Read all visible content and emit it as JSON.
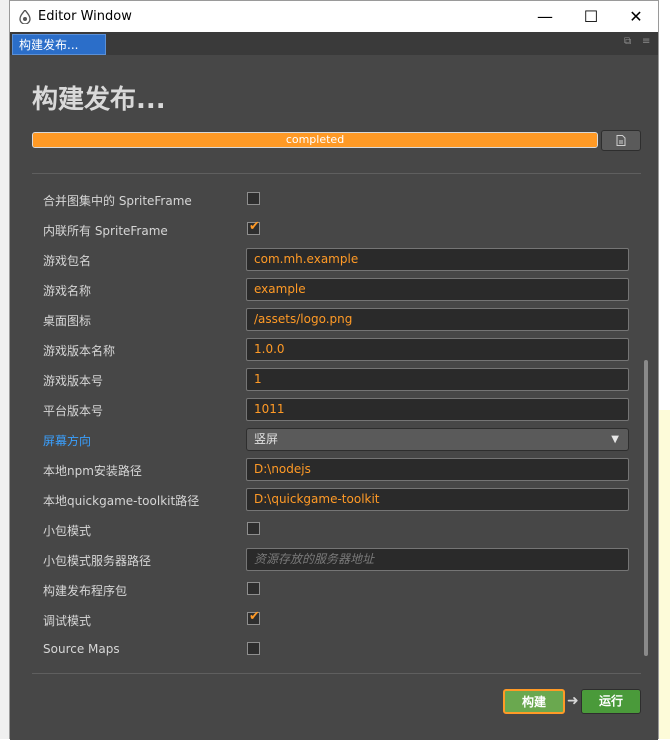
{
  "window": {
    "title": "Editor Window",
    "controls": {
      "minimize": "—",
      "maximize": "☐",
      "close": "✕"
    }
  },
  "tab": {
    "label": "构建发布..."
  },
  "panel": {
    "heading": "构建发布...",
    "progress": {
      "label": "completed",
      "percent": 100
    },
    "fields": [
      {
        "label": "合并图集中的 SpriteFrame",
        "type": "checkbox",
        "checked": false
      },
      {
        "label": "内联所有 SpriteFrame",
        "type": "checkbox",
        "checked": true
      },
      {
        "label": "游戏包名",
        "type": "text",
        "value": "com.mh.example"
      },
      {
        "label": "游戏名称",
        "type": "text",
        "value": "example"
      },
      {
        "label": "桌面图标",
        "type": "text",
        "value": "/assets/logo.png"
      },
      {
        "label": "游戏版本名称",
        "type": "text",
        "value": "1.0.0"
      },
      {
        "label": "游戏版本号",
        "type": "text",
        "value": "1"
      },
      {
        "label": "平台版本号",
        "type": "text",
        "value": "1011"
      },
      {
        "label": "屏幕方向",
        "type": "select",
        "value": "竖屏",
        "link": true
      },
      {
        "label": "本地npm安装路径",
        "type": "text",
        "value": "D:\\nodejs"
      },
      {
        "label": "本地quickgame-toolkit路径",
        "type": "text",
        "value": "D:\\quickgame-toolkit"
      },
      {
        "label": "小包模式",
        "type": "checkbox",
        "checked": false
      },
      {
        "label": "小包模式服务器路径",
        "type": "text",
        "value": "",
        "placeholder": "资源存放的服务器地址"
      },
      {
        "label": "构建发布程序包",
        "type": "checkbox",
        "checked": false
      },
      {
        "label": "调试模式",
        "type": "checkbox",
        "checked": true
      },
      {
        "label": "Source Maps",
        "type": "checkbox",
        "checked": false
      }
    ],
    "buttons": {
      "build": "构建",
      "run": "运行"
    }
  },
  "colors": {
    "accent": "#ff9a26",
    "panel_bg": "#474747",
    "link": "#3aa0ff",
    "tab_active": "#2b6ec9",
    "build_button": "#6aa84f",
    "run_button": "#4a9a3a"
  }
}
